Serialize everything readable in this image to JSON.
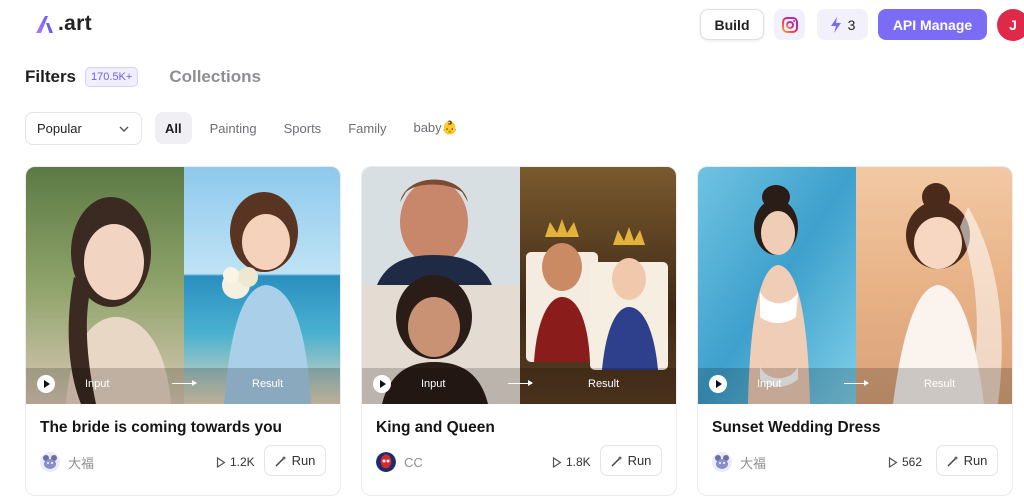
{
  "header": {
    "logo_text": ".art",
    "build_label": "Build",
    "credits": "3",
    "api_label": "API Manage",
    "avatar_initial": "J",
    "icons": [
      "logo-mark",
      "instagram-icon",
      "lightning-icon"
    ]
  },
  "tabs": {
    "filters_label": "Filters",
    "filters_count": "170.5K+",
    "collections_label": "Collections"
  },
  "sort": {
    "selected": "Popular"
  },
  "chips": [
    {
      "label": "All",
      "active": true
    },
    {
      "label": "Painting"
    },
    {
      "label": "Sports"
    },
    {
      "label": "Family"
    },
    {
      "label": "baby👶"
    }
  ],
  "io_labels": {
    "input": "Input",
    "result": "Result"
  },
  "cards": [
    {
      "title": "The bride is coming towards you",
      "author": "大福",
      "runs": "1.2K",
      "run_label": "Run"
    },
    {
      "title": "King and Queen",
      "author": "CC",
      "runs": "1.8K",
      "run_label": "Run"
    },
    {
      "title": "Sunset Wedding Dress",
      "author": "大福",
      "runs": "562",
      "run_label": "Run"
    }
  ],
  "colors": {
    "accent": "#7b6cf6",
    "avatar": "#e0284a",
    "badge_bg": "#f1eefe"
  }
}
